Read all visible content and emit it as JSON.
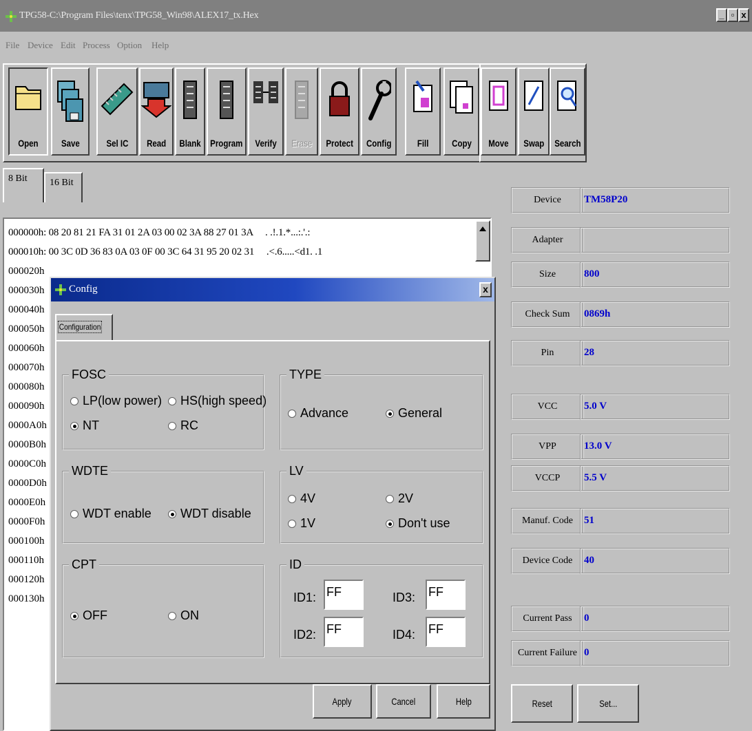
{
  "window": {
    "title": "TPG58-C:\\Program Files\\tenx\\TPG58_Win98\\ALEX17_tx.Hex",
    "controls": [
      "_",
      "▫",
      "x"
    ]
  },
  "menu": [
    "File",
    "Device",
    "Edit",
    "Process",
    "Option",
    "Help"
  ],
  "toolbar": [
    "Open",
    "Save",
    "Sel IC",
    "Read",
    "Blank",
    "Program",
    "Verify",
    "Erase",
    "Protect",
    "Config",
    "Fill",
    "Copy",
    "Move",
    "Swap",
    "Search"
  ],
  "tabs": [
    "8 Bit",
    "16 Bit"
  ],
  "hex": {
    "line0": "000000h: 08 20 81 21 FA 31 01 2A 03 00 02 3A 88 27 01 3A     . .!.1.*...:.'.:",
    "line1": "000010h: 00 3C 0D 36 83 0A 03 0F 00 3C 64 31 95 20 02 31     .<.6.....<d1. .1",
    "addresses": [
      "000020h",
      "000030h",
      "000040h",
      "000050h",
      "000060h",
      "000070h",
      "000080h",
      "000090h",
      "0000A0h",
      "0000B0h",
      "0000C0h",
      "0000D0h",
      "0000E0h",
      "0000F0h",
      "000100h",
      "000110h",
      "000120h",
      "000130h"
    ]
  },
  "info": {
    "device": {
      "label": "Device",
      "value": "TM58P20"
    },
    "adapter": {
      "label": "Adapter",
      "value": ""
    },
    "size": {
      "label": "Size",
      "value": "800"
    },
    "checksum": {
      "label": "Check Sum",
      "value": "0869h"
    },
    "pin": {
      "label": "Pin",
      "value": "28"
    },
    "vcc": {
      "label": "VCC",
      "value": "5.0 V"
    },
    "vpp": {
      "label": "VPP",
      "value": "13.0 V"
    },
    "vccp": {
      "label": "VCCP",
      "value": "5.5 V"
    },
    "manuf": {
      "label": "Manuf. Code",
      "value": "51"
    },
    "devcode": {
      "label": "Device Code",
      "value": "40"
    },
    "pass": {
      "label": "Current Pass",
      "value": "0"
    },
    "fail": {
      "label": "Current Failure",
      "value": "0"
    },
    "reset_label": "Reset",
    "set_label": "Set..."
  },
  "dialog": {
    "title": "Config",
    "close": "x",
    "tab": "Configuration",
    "fosc": {
      "title": "FOSC",
      "lp": "LP(low power)",
      "hs": "HS(high speed)",
      "nt": "NT",
      "rc": "RC",
      "selected": "NT"
    },
    "type": {
      "title": "TYPE",
      "advance": "Advance",
      "general": "General",
      "selected": "General"
    },
    "wdte": {
      "title": "WDTE",
      "enable": "WDT enable",
      "disable": "WDT disable",
      "selected": "WDT disable"
    },
    "lv": {
      "title": "LV",
      "v4": "4V",
      "v2": "2V",
      "v1": "1V",
      "dontuse": "Don't use",
      "selected": "Don't use"
    },
    "cpt": {
      "title": "CPT",
      "off": "OFF",
      "on": "ON",
      "selected": "OFF"
    },
    "id": {
      "title": "ID",
      "id1_label": "ID1:",
      "id2_label": "ID2:",
      "id3_label": "ID3:",
      "id4_label": "ID4:",
      "id1": "FF",
      "id2": "FF",
      "id3": "FF",
      "id4": "FF"
    },
    "apply_label": "Apply",
    "cancel_label": "Cancel",
    "help_label": "Help"
  },
  "colors": {
    "title_inactive": "#808080",
    "dialog_title": "#0a2a8c",
    "value_blue": "#0000cc",
    "face": "#c0c0c0"
  }
}
